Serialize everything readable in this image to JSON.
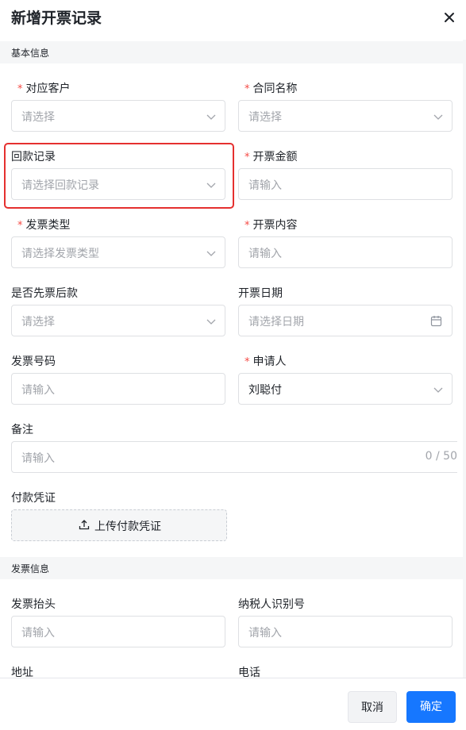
{
  "dialog": {
    "title": "新增开票记录",
    "close_icon": "close-icon"
  },
  "sections": {
    "basic": "基本信息",
    "invoice": "发票信息"
  },
  "fields": {
    "customer": {
      "label": "对应客户",
      "required": "*",
      "placeholder": "请选择"
    },
    "contract": {
      "label": "合同名称",
      "required": "*",
      "placeholder": "请选择"
    },
    "payment_record": {
      "label": "回款记录",
      "placeholder": "请选择回款记录"
    },
    "amount": {
      "label": "开票金额",
      "required": "*",
      "placeholder": "请输入"
    },
    "invoice_type": {
      "label": "发票类型",
      "required": "*",
      "placeholder": "请选择发票类型"
    },
    "content": {
      "label": "开票内容",
      "required": "*",
      "placeholder": "请输入"
    },
    "invoice_first": {
      "label": "是否先票后款",
      "placeholder": "请选择"
    },
    "invoice_date": {
      "label": "开票日期",
      "placeholder": "请选择日期"
    },
    "invoice_number": {
      "label": "发票号码",
      "placeholder": "请输入"
    },
    "applicant": {
      "label": "申请人",
      "required": "*",
      "value": "刘聪付"
    },
    "remark": {
      "label": "备注",
      "placeholder": "请输入",
      "counter": "0 / 50"
    },
    "voucher": {
      "label": "付款凭证",
      "upload_label": "上传付款凭证"
    },
    "invoice_header": {
      "label": "发票抬头",
      "placeholder": "请输入"
    },
    "taxpayer_id": {
      "label": "纳税人识别号",
      "placeholder": "请输入"
    },
    "address": {
      "label": "地址"
    },
    "phone": {
      "label": "电话"
    }
  },
  "footer": {
    "cancel_label": "取消",
    "ok_label": "确定"
  },
  "colors": {
    "primary": "#1677ff",
    "required": "#f54a45",
    "highlight": "#e5302f"
  }
}
